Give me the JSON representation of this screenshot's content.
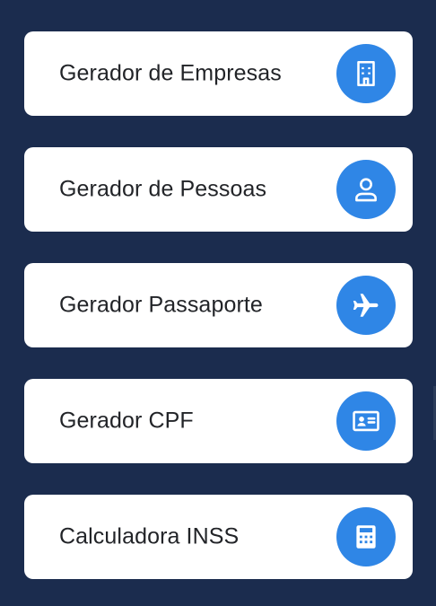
{
  "accent_color": "#2f86e6",
  "background_color": "#1b2c4e",
  "cards": [
    {
      "label": "Gerador de Empresas",
      "icon": "building-icon"
    },
    {
      "label": "Gerador de Pessoas",
      "icon": "person-icon"
    },
    {
      "label": "Gerador Passaporte",
      "icon": "airplane-icon"
    },
    {
      "label": "Gerador CPF",
      "icon": "id-card-icon"
    },
    {
      "label": "Calculadora INSS",
      "icon": "calculator-icon"
    }
  ]
}
